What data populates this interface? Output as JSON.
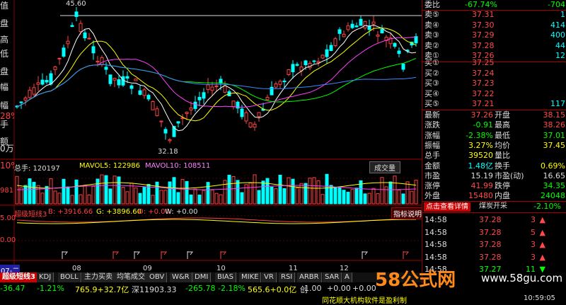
{
  "left_labels": [
    "值",
    "盘",
    "高",
    "低",
    "盘",
    "幅",
    "幅",
    "28%",
    "手",
    "额",
    "0万",
    "10%"
  ],
  "main_chart": {
    "high_label": "45.60",
    "low_label": "32.18"
  },
  "volume_header": {
    "prefix": "总手: 120197",
    "mavol5": "MAVOL5: 122986",
    "mavol10": "MAVOL10: 108511",
    "indicator": "成交量",
    "axis_label": "981"
  },
  "indicator_header": {
    "name": "超级短线3",
    "b": "B: +3916.66",
    "g": "G: +3896.60",
    "d": "D: +0.00",
    "w": "W: +0.00",
    "help": "指标说明",
    "axis_label": "5.00",
    "axis_label2": "0.00"
  },
  "x_axis": {
    "labels": [
      "08",
      "09",
      "10",
      "11",
      "12"
    ],
    "corner": "07-二"
  },
  "tabs": [
    "超级短线3",
    "KDJ",
    "BOLL",
    "主力买卖",
    "均笔成交",
    "OBV",
    "W&R",
    "DMI",
    "BIAS",
    "MIKE",
    "VR",
    "RSI",
    "ARBR",
    "SAR",
    "A"
  ],
  "quote": {
    "weibi_label": "委比",
    "weibi_value": "-67.74%",
    "weibi_vol": "-704",
    "sells": [
      {
        "label": "卖⑤",
        "price": "37.31",
        "vol": "1"
      },
      {
        "label": "卖④",
        "price": "37.30",
        "vol": "414"
      },
      {
        "label": "卖③",
        "price": "37.29",
        "vol": "400"
      },
      {
        "label": "卖②",
        "price": "37.28",
        "vol": "44"
      },
      {
        "label": "卖①",
        "price": "37.26",
        "vol": "12"
      }
    ],
    "buys": [
      {
        "label": "买①",
        "price": "37.25",
        "vol": ""
      },
      {
        "label": "买②",
        "price": "37.24",
        "vol": ""
      },
      {
        "label": "买③",
        "price": "37.23",
        "vol": ""
      },
      {
        "label": "买④",
        "price": "37.22",
        "vol": ""
      },
      {
        "label": "买⑤",
        "price": "37.21",
        "vol": "117"
      }
    ],
    "stats": [
      {
        "k1": "最新",
        "v1": "37.26",
        "k2": "开盘",
        "v2": "38.15",
        "c1": "#ff4a4a",
        "c2": "#ff4a4a"
      },
      {
        "k1": "涨跌",
        "v1": "-0.91",
        "k2": "最高",
        "v2": "38.26",
        "c1": "#00ff00",
        "c2": "#ff4a4a"
      },
      {
        "k1": "涨幅",
        "v1": "-2.38%",
        "k2": "最低",
        "v2": "37.01",
        "c1": "#00ff00",
        "c2": "#00ff00"
      },
      {
        "k1": "振幅",
        "v1": "3.27%",
        "k2": "均价",
        "v2": "37.45",
        "c1": "#ffff00",
        "c2": "#ffff00"
      },
      {
        "k1": "总手",
        "v1": "39520",
        "k2": "量比",
        "v2": "",
        "c1": "#ffff00",
        "c2": "#ffff00"
      },
      {
        "k1": "金额",
        "v1": "1.48亿",
        "k2": "换手",
        "v2": "0.69%",
        "c1": "#00ffff",
        "c2": "#ffff00"
      },
      {
        "k1": "市盈",
        "v1": "15.19",
        "k2": "市盈(动)",
        "v2": "16.65",
        "c1": "#ddd",
        "c2": "#ddd"
      },
      {
        "k1": "涨停",
        "v1": "41.99",
        "k2": "跌停",
        "v2": "34.35",
        "c1": "#ff4a4a",
        "c2": "#00ff00"
      },
      {
        "k1": "外盘",
        "v1": "15480",
        "k2": "内盘",
        "v2": "24048",
        "c1": "#ff4a4a",
        "c2": "#00ff00"
      }
    ],
    "details_link": "点击查看详情",
    "sector": "煤炭开采",
    "sector_change": "-2.10%",
    "ticks": [
      {
        "time": "14:58",
        "price": "37.28",
        "vol": "3",
        "dir": "up"
      },
      {
        "time": "14:58",
        "price": "37.28",
        "vol": "5",
        "dir": "up"
      },
      {
        "time": "14:58",
        "price": "37.28",
        "vol": "3",
        "dir": "up"
      },
      {
        "time": "14:58",
        "price": "37.28",
        "vol": "3",
        "dir": "up"
      },
      {
        "time": "14:58",
        "price": "37.27",
        "vol": "11",
        "dir": "down"
      }
    ]
  },
  "status_bar": {
    "item1": "-36.47",
    "item2": "-1.21%",
    "item3": "765.9+32.7亿",
    "item4": "深11903.33",
    "item5": "-265.78",
    "item6": "-2.18%",
    "item7": "565.6+0.0亿",
    "item8": "创",
    "item9": "1.00",
    "item10": "+0.00",
    "item11": "+0.00",
    "ticker": "同花顺大机构软件是盈利制",
    "time": "10:59:05"
  },
  "watermark": {
    "text": "58公式网",
    "url": "www.58gu.com"
  },
  "colors": {
    "up": "#ff4040",
    "down": "#00ffff",
    "accent": "#c00000"
  }
}
